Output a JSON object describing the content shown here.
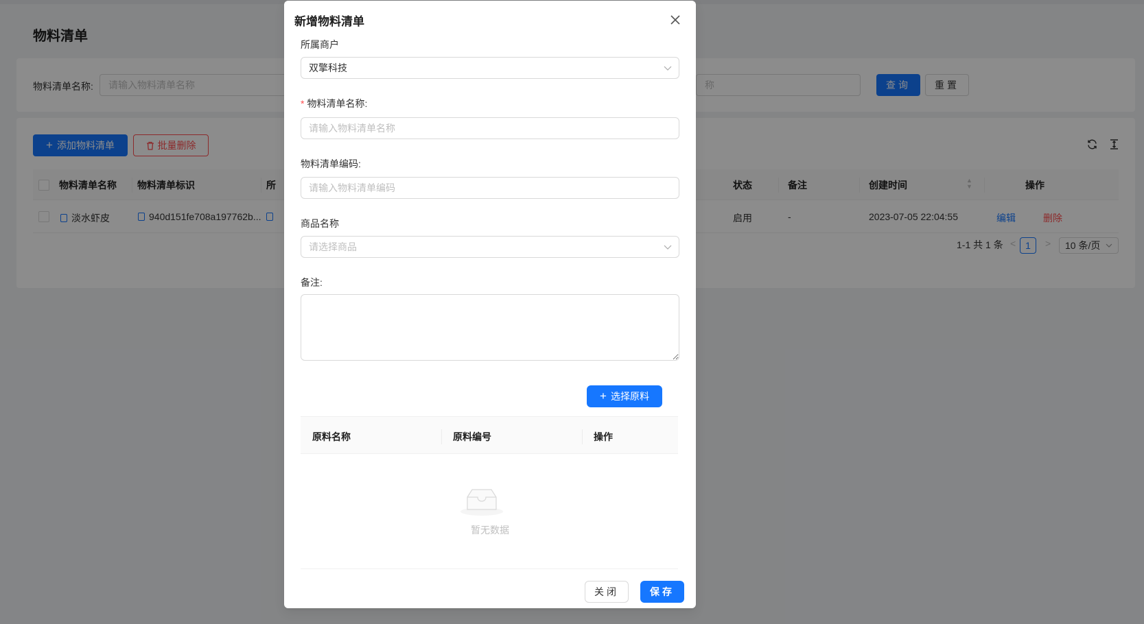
{
  "page": {
    "title": "物料清单",
    "search": {
      "label": "物料清单名称:",
      "placeholder": "请输入物料清单名称",
      "second_placeholder_fragment": "称",
      "query_label": "查询",
      "reset_label": "重置"
    },
    "toolbar": {
      "add_label": "添加物料清单",
      "batch_delete_label": "批量删除",
      "refresh_icon": "refresh-icon",
      "column_height_icon": "column-height-icon"
    },
    "table": {
      "columns": [
        "物料清单名称",
        "物料清单标识",
        "所",
        "状态",
        "备注",
        "创建时间",
        "操作"
      ],
      "rows": [
        {
          "name": "淡水虾皮",
          "identifier": "940d151fe708a197762b...",
          "status": "启用",
          "remark": "-",
          "created_at": "2023-07-05 22:04:55",
          "edit_label": "编辑",
          "delete_label": "删除"
        }
      ]
    },
    "pagination": {
      "summary": "1-1 共 1 条",
      "current_page": "1",
      "page_size": "10 条/页"
    }
  },
  "modal": {
    "title": "新增物料清单",
    "fields": {
      "merchant": {
        "label": "所属商户",
        "value": "双擎科技"
      },
      "bom_name": {
        "label": "物料清单名称:",
        "required": "*",
        "placeholder": "请输入物料清单名称"
      },
      "bom_code": {
        "label": "物料清单编码:",
        "placeholder": "请输入物料清单编码"
      },
      "product": {
        "label": "商品名称",
        "placeholder": "请选择商品"
      },
      "remark": {
        "label": "备注:"
      }
    },
    "pick_material_label": "选择原料",
    "material_table": {
      "columns": [
        "原料名称",
        "原料编号",
        "操作"
      ],
      "empty_text": "暂无数据"
    },
    "footer": {
      "close_label": "关闭",
      "save_label": "保存"
    }
  },
  "colors": {
    "primary": "#1677ff",
    "danger": "#ff4d4f",
    "mask": "rgba(0,0,0,0.45)"
  }
}
